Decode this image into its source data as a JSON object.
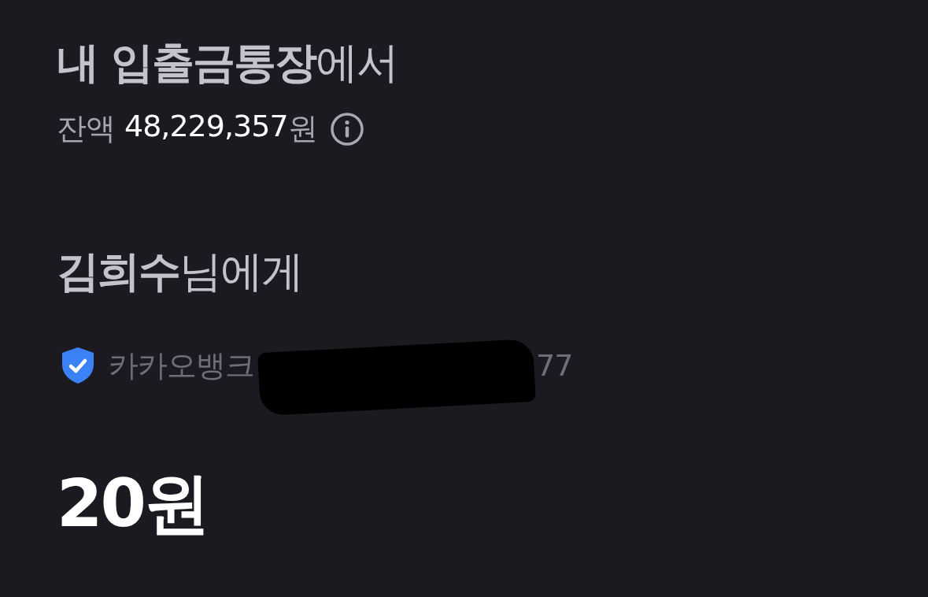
{
  "from": {
    "title": "**내 입출금통장**에서",
    "balance_label": "잔액",
    "balance_amount": "48,229,357",
    "balance_unit": "원"
  },
  "to": {
    "title": "**김희수**님에게",
    "verified": true,
    "bank": "카카오뱅크",
    "account_tail": "77"
  },
  "amount": "20원"
}
